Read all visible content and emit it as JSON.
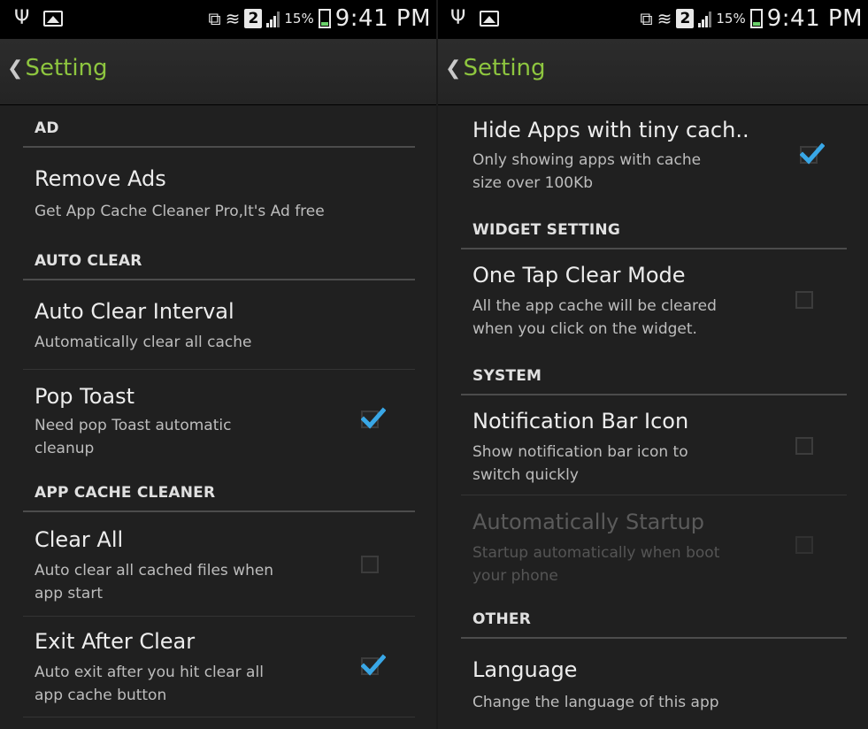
{
  "status_bar": {
    "usb_icon": "usb-icon",
    "gallery_icon": "picture-icon",
    "battery_percent": "15%",
    "sim_label": "2",
    "time": "9:41 PM"
  },
  "left": {
    "title": "Setting",
    "categories": {
      "ad": "AD",
      "auto_clear": "AUTO CLEAR",
      "app_cache": "APP CACHE CLEANER"
    },
    "items": {
      "remove_ads": {
        "title": "Remove Ads",
        "subtitle": "Get App Cache Cleaner Pro,It's Ad free"
      },
      "auto_clear_interval": {
        "title": "Auto Clear Interval",
        "subtitle": "Automatically clear all cache"
      },
      "pop_toast": {
        "title": "Pop Toast",
        "subtitle_1": "Need pop Toast automatic",
        "subtitle_2": "cleanup",
        "checked": true
      },
      "clear_all": {
        "title": "Clear All",
        "subtitle_1": "Auto clear all cached files when",
        "subtitle_2": "app start",
        "checked": false
      },
      "exit_after_clear": {
        "title": "Exit After Clear",
        "subtitle_1": "Auto exit after you hit clear all",
        "subtitle_2": "app cache button",
        "checked": true
      }
    }
  },
  "right": {
    "title": "Setting",
    "categories": {
      "widget": "WIDGET SETTING",
      "system": "SYSTEM",
      "other": "OTHER"
    },
    "items": {
      "hide_apps": {
        "title": "Hide Apps with tiny cach..",
        "subtitle_1": "Only showing apps with cache",
        "subtitle_2": "size over 100Kb",
        "checked": true
      },
      "one_tap": {
        "title": "One Tap Clear Mode",
        "subtitle_1": "All the app cache will be cleared",
        "subtitle_2": "when you click on the widget.",
        "checked": false
      },
      "notification_icon": {
        "title": "Notification Bar Icon",
        "subtitle_1": "Show notification bar icon to",
        "subtitle_2": "switch quickly",
        "checked": false
      },
      "auto_startup": {
        "title": "Automatically Startup",
        "subtitle_1": "Startup automatically when boot",
        "subtitle_2": "your phone",
        "checked": false,
        "enabled": false
      },
      "language": {
        "title": "Language",
        "subtitle": "Change the language of this app"
      }
    }
  },
  "colors": {
    "accent_title": "#8ec63f",
    "checkmark": "#39a7e6",
    "background": "#202020"
  }
}
